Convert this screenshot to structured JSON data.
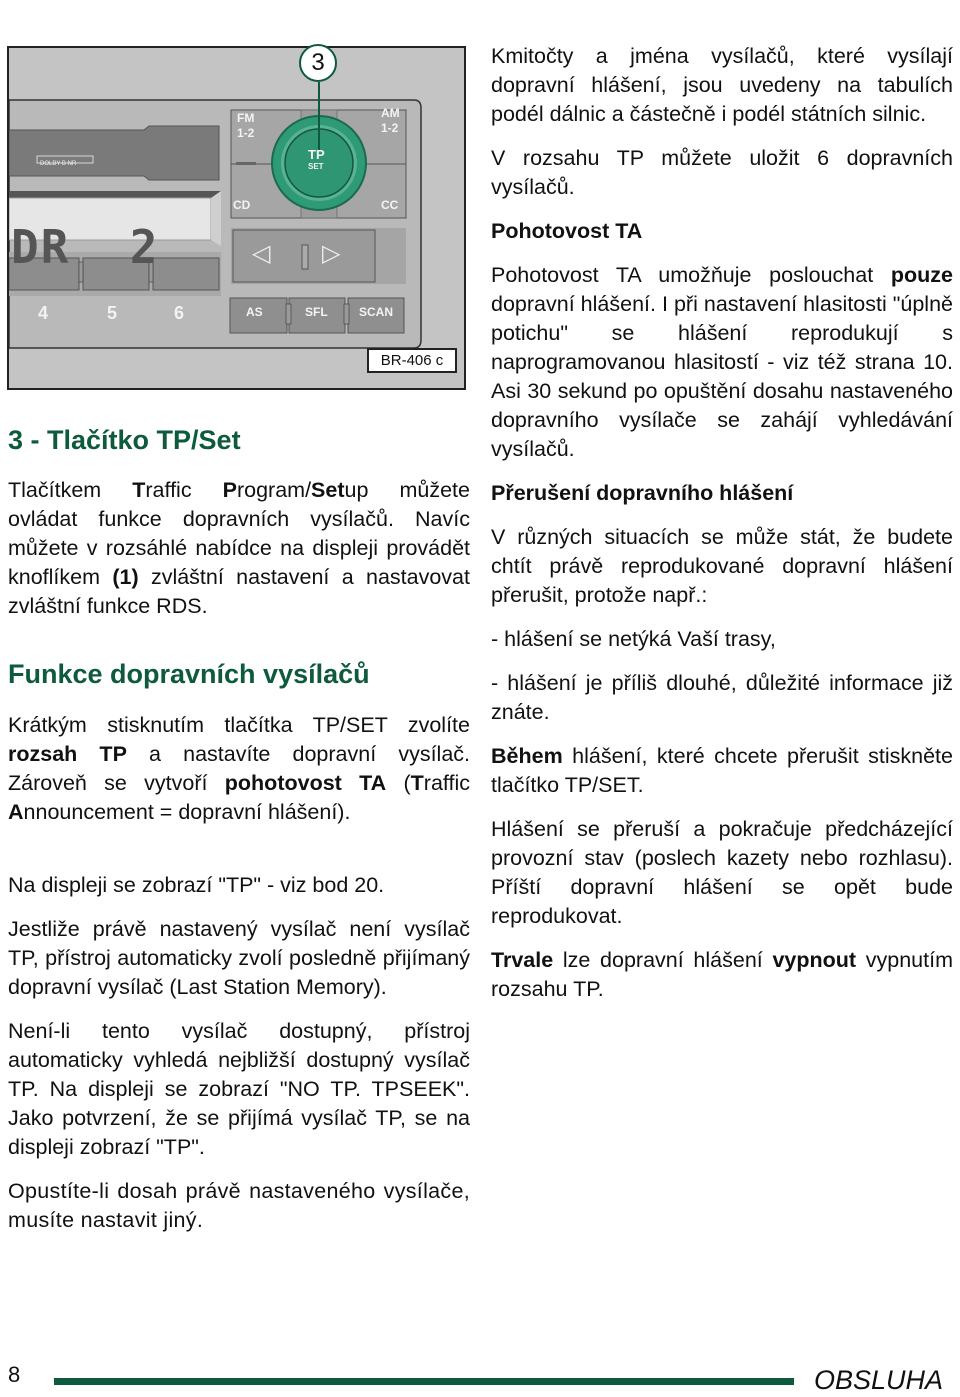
{
  "figure": {
    "callout_number": "3",
    "figure_code": "BR-406 c",
    "dolby_label": "DOLBY B NR",
    "display_text": "DR  2",
    "buttons": {
      "fm": "FM",
      "fm_sub": "1-2",
      "am": "AM",
      "am_sub": "1-2",
      "cd": "CD",
      "cc": "CC",
      "tp": "TP",
      "tp_sub": "SET",
      "seek_left_icon": "◁",
      "seek_right_icon": "▷",
      "preset_4": "4",
      "preset_5": "5",
      "preset_6": "6",
      "as": "AS",
      "sfl": "SFL",
      "scan": "SCAN"
    },
    "colors": {
      "accent_green": "#0e5a3c",
      "knob_green": "#2e9a76"
    }
  },
  "left": {
    "section1_heading": "3 - Tlačítko TP/Set",
    "section1_p1": {
      "t1": "Tlačítkem ",
      "b1": "T",
      "t2": "raffic ",
      "b2": "P",
      "t3": "rogram/",
      "b3": "Set",
      "t4": "up můžete ovládat funkce dopravních vysílačů. Navíc můžete v rozsáhlé nabídce na displeji provádět knoflíkem ",
      "b4": "(1)",
      "t5": " zvláštní nastavení a nastavovat zvláštní funkce RDS."
    },
    "section2_heading": "Funkce dopravních vysílačů",
    "section2_p1": {
      "t1": "Krátkým stisknutím tlačítka TP/SET zvolíte ",
      "b1": "rozsah TP",
      "t2": " a nastavíte dopravní vysílač. Zároveň se vytvoří ",
      "b2": "pohotovost TA",
      "t3": " (",
      "b3": "T",
      "t4": "raffic ",
      "b4": "A",
      "t5": "nnouncement = dopravní hlášení)."
    },
    "p_display_tp": "Na displeji se zobrazí \"TP\" - viz bod 20.",
    "p_last_station": "Jestliže právě nastavený vysílač není vysílač TP, přístroj automaticky zvolí posledně přijímaný dopravní vysílač (Last Station Memory).",
    "p_not_available": "Není-li tento vysílač dostupný, přístroj automaticky vyhledá nejbližší dostupný vysílač TP. Na displeji se zobrazí \"NO TP. TPSEEK\". Jako potvrzení, že se přijímá vysílač TP, se na displeji zobrazí \"TP\".",
    "p_leave_range": "Opustíte-li dosah právě nastaveného vysílače, musíte nastavit jiný."
  },
  "right": {
    "p_frequencies": "Kmitočty a jména vysílačů, které vysílají dopravní hlášení, jsou uvedeny na tabulích podél dálnic a částečně i podél státních silnic.",
    "p_store": "V rozsahu TP můžete uložit 6 dopravních vysílačů.",
    "heading_ta": "Pohotovost TA",
    "p_ta": {
      "t1": "Pohotovost TA umožňuje poslouchat ",
      "b1": "pouze",
      "t2": " dopravní hlášení. I při nastavení hlasitosti \"úplně potichu\" se hlášení reprodukují s naprogramovanou hlasitostí - viz též strana 10. Asi 30 sekund po opuštění dosahu nastaveného dopravního vysílače se zahájí vyhledávání vysílačů."
    },
    "heading_interrupt": "Přerušení dopravního hlášení",
    "p_situations": "V různých situacích se může stát, že budete chtít právě reprodukované dopravní hlášení přerušit, protože např.:",
    "bullet_1": "- hlášení se netýká Vaší trasy,",
    "bullet_2": "- hlášení je příliš dlouhé, důležité informace již znáte.",
    "p_during": {
      "b1": "Během",
      "t1": " hlášení, které chcete přerušit stiskněte tlačítko TP/SET."
    },
    "p_resume": "Hlášení se přeruší a pokračuje předcházející provozní stav (poslech kazety nebo rozhlasu). Příští dopravní hlášení se opět bude reprodukovat.",
    "p_permanent": {
      "b1": "Trvale",
      "t1": " lze dopravní hlášení ",
      "b2": "vypnout",
      "t2": " vypnutím rozsahu TP."
    }
  },
  "footer": {
    "page_number": "8",
    "section_title": "OBSLUHA"
  }
}
